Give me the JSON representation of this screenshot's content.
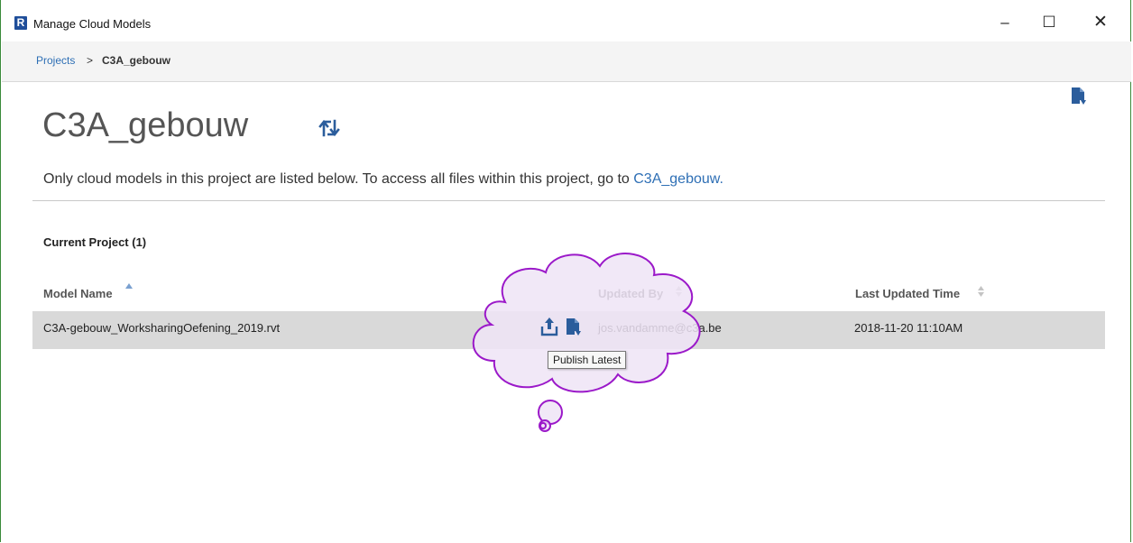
{
  "window": {
    "title": "Manage Cloud Models",
    "logo_letter": "R",
    "minimize_label": "–",
    "maximize_label": "☐",
    "close_label": "✕"
  },
  "breadcrumb": {
    "projects_label": "Projects",
    "separator": ">",
    "current": "C3A_gebouw"
  },
  "page": {
    "title": "C3A_gebouw",
    "intro_text": "Only cloud models in this project are listed below. To access all files within this project, go to ",
    "intro_link": "C3A_gebouw.",
    "section_title": "Current Project (1)"
  },
  "table": {
    "columns": [
      {
        "label": "Model Name"
      },
      {
        "label": "Updated By"
      },
      {
        "label": "Last Updated Time"
      }
    ],
    "rows": [
      {
        "model_name": "C3A-gebouw_WorksharingOefening_2019.rvt",
        "updated_by": "jos.vandamme@c3a.be",
        "last_updated": "2018-11-20 11:10AM"
      }
    ]
  },
  "tooltip": {
    "text": "Publish Latest"
  },
  "icons": {
    "app": "revit-logo-icon",
    "refresh": "refresh-icon",
    "download": "download-icon",
    "publish": "publish-icon"
  },
  "colors": {
    "accent_blue": "#2e6fb5",
    "icon_blue": "#2b5d9c",
    "row_selected": "#d9d9d9",
    "annotation_purple": "#9b19c9",
    "annotation_fill": "#efe4f6"
  }
}
